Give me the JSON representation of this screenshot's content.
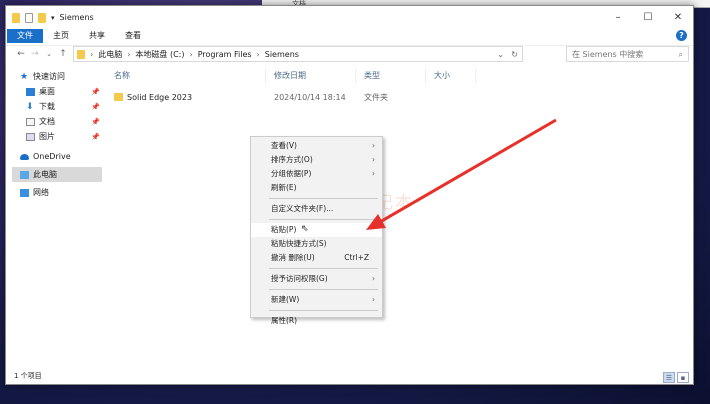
{
  "background_window": {
    "text": "文档"
  },
  "window": {
    "title": "Siemens",
    "controls": [
      "–",
      "☐",
      "✕"
    ]
  },
  "ribbon": {
    "tabs": [
      "文件",
      "主页",
      "共享",
      "查看"
    ],
    "help": "?"
  },
  "address": {
    "crumbs": [
      "此电脑",
      "本地磁盘 (C:)",
      "Program Files",
      "Siemens"
    ],
    "search_placeholder": "在 Siemens 中搜索"
  },
  "sidebar": {
    "items": [
      {
        "label": "快速访问"
      },
      {
        "label": "桌面"
      },
      {
        "label": "下载"
      },
      {
        "label": "文档"
      },
      {
        "label": "图片"
      },
      {
        "label": "OneDrive"
      },
      {
        "label": "此电脑"
      },
      {
        "label": "网络"
      }
    ]
  },
  "columns": [
    "名称",
    "修改日期",
    "类型",
    "大小"
  ],
  "files": [
    {
      "name": "Solid Edge 2023",
      "date": "2024/10/14 18:14",
      "type": "文件夹",
      "size": ""
    }
  ],
  "status": "1 个项目",
  "context_menu": {
    "items": [
      "查看(V)",
      "排序方式(O)",
      "分组依据(P)",
      "刷新(E)",
      "自定义文件夹(F)...",
      "粘贴(P)",
      "粘贴快捷方式(S)",
      "撤消 删除(U)",
      "授予访问权限(G)",
      "新建(W)",
      "属性(R)"
    ],
    "shortcut": "Ctrl+Z"
  },
  "watermark": "丁同学日记本",
  "colors": {
    "accent": "#1a6fc9",
    "arrow": "#e8302a"
  }
}
